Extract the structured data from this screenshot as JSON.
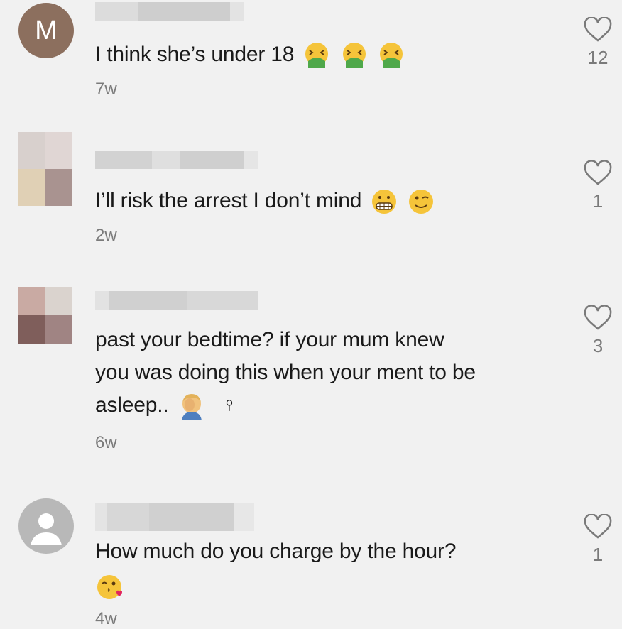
{
  "comments": [
    {
      "avatar_letter": "M",
      "text": "I think she’s under 18",
      "time": "7w",
      "likes": "12",
      "emoji": [
        "face-vomiting",
        "face-vomiting",
        "face-vomiting"
      ]
    },
    {
      "avatar_letter": "",
      "text": "I’ll risk the arrest I don’t mind",
      "time": "2w",
      "likes": "1",
      "emoji": [
        "grimacing-face",
        "winking-face"
      ]
    },
    {
      "avatar_letter": "",
      "text_lines": [
        "past your bedtime? if your mum knew",
        "you was doing this when your ment to be",
        "asleep.."
      ],
      "female_sign": "♀",
      "time": "6w",
      "likes": "3",
      "emoji": [
        "woman-facepalming"
      ]
    },
    {
      "avatar_letter": "",
      "text": "How much do you charge by the hour?",
      "time": "4w",
      "likes": "1",
      "emoji": [
        "face-blowing-kiss"
      ]
    }
  ],
  "icons": {
    "like": "heart-outline-icon"
  },
  "colors": {
    "background": "#f1f1f1",
    "text": "#1a1a1a",
    "secondary": "#7a7a7a",
    "avatar_m": "#8c6f5e"
  }
}
